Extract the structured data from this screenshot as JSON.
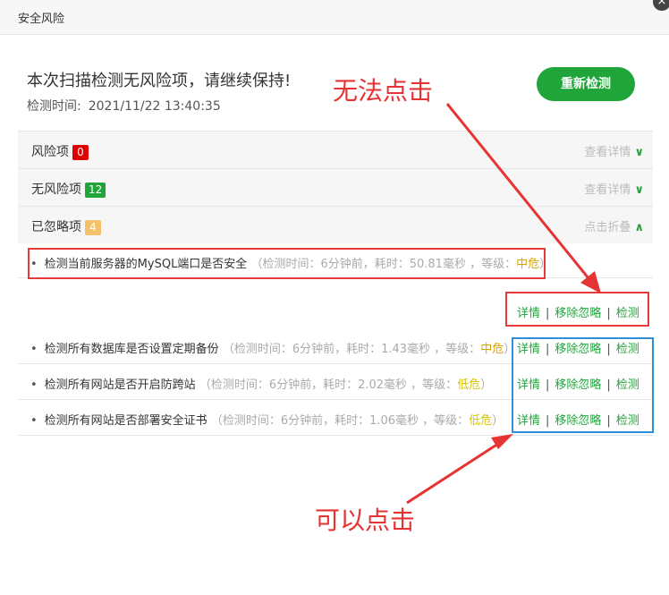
{
  "dialog": {
    "title": "安全风险"
  },
  "summary": {
    "headline": "本次扫描检测无风险项，请继续保持!",
    "scan_time_label": "检测时间:",
    "scan_time_value": "2021/11/22 13:40:35",
    "rescan_label": "重新检测"
  },
  "sections": [
    {
      "label": "风险项",
      "count": "0",
      "count_color": "#e00000",
      "toggle": "查看详情",
      "chevron": "∨"
    },
    {
      "label": "无风险项",
      "count": "12",
      "count_color": "#20a53a",
      "toggle": "查看详情",
      "chevron": "∨"
    },
    {
      "label": "已忽略项",
      "count": "4",
      "count_color": "#f5c06a",
      "toggle": "点击折叠",
      "chevron": "∧"
    }
  ],
  "ignored_items": [
    {
      "name": "检测当前服务器的MySQL端口是否安全",
      "meta": "（检测时间：6分钟前，耗时：50.81毫秒 ，等级：",
      "level": "中危",
      "close": "）"
    },
    {
      "name": "检测所有数据库是否设置定期备份",
      "meta": "（检测时间：6分钟前，耗时：1.43毫秒 ，等级：",
      "level": "中危",
      "close": "）"
    },
    {
      "name": "检测所有网站是否开启防跨站",
      "meta": "（检测时间：6分钟前，耗时：2.02毫秒 ，等级：",
      "level": "低危",
      "close": "）"
    },
    {
      "name": "检测所有网站是否部署安全证书",
      "meta": "（检测时间：6分钟前，耗时：1.06毫秒 ，等级：",
      "level": "低危",
      "close": "）"
    }
  ],
  "actions": {
    "detail": "详情",
    "remove_ignore": "移除忽略",
    "check": "检测",
    "sep": "|"
  },
  "annotations": {
    "cannot_click": "无法点击",
    "can_click": "可以点击"
  },
  "colors": {
    "accent": "#20a53a",
    "annotation_red": "#e63434",
    "annotation_blue": "#2f8fd9"
  }
}
